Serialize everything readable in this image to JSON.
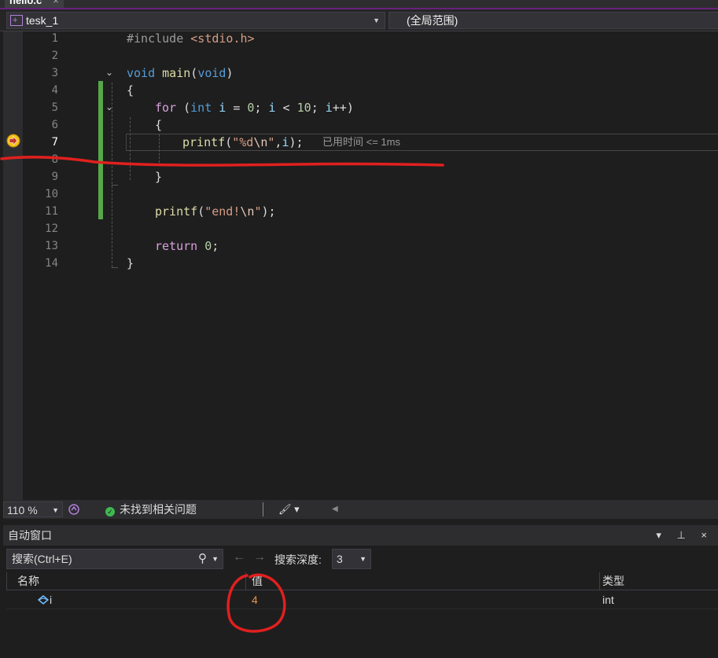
{
  "tab": {
    "title": "hello.c",
    "close": "×"
  },
  "navbar": {
    "project": "tesk_1",
    "scope": "(全局范围)"
  },
  "editor": {
    "line_numbers": [
      "1",
      "2",
      "3",
      "4",
      "5",
      "6",
      "7",
      "8",
      "9",
      "10",
      "11",
      "12",
      "13",
      "14"
    ],
    "current_line": "7",
    "elapsed": "已用时间 <= 1ms"
  },
  "code": {
    "l1_pp": "#include ",
    "l1_hdr": "<stdio.h>",
    "l3_void": "void",
    "l3_main": " main",
    "l3_paren": "(",
    "l3_void2": "void",
    "l3_close": ")",
    "brace_open": "{",
    "brace_close": "}",
    "l5_for": "for",
    "l5_a": " (",
    "l5_int": "int",
    "l5_i": " i",
    "l5_eq": " = ",
    "l5_0": "0",
    "l5_semi": "; ",
    "l5_i2": "i",
    "l5_lt": " < ",
    "l5_10": "10",
    "l5_semi2": "; ",
    "l5_i3": "i",
    "l5_pp": "++)",
    "l7_printf": "printf",
    "l7_open": "(",
    "l7_str1": "\"%d",
    "l7_esc": "\\n",
    "l7_str2": "\"",
    "l7_rest": ",",
    "l7_i": "i",
    "l7_end": ");",
    "l11_printf": "printf",
    "l11_open": "(",
    "l11_str1": "\"end!",
    "l11_esc": "\\n",
    "l11_str2": "\"",
    "l11_end": ");",
    "l13_return": "return",
    "l13_sp": " ",
    "l13_0": "0",
    "l13_semi": ";"
  },
  "statusbar": {
    "zoom": "110 %",
    "issues": "未找到相关问题"
  },
  "autos": {
    "title": "自动窗口",
    "window_controls": "▾ ⊥ ×",
    "search_placeholder": "搜索(Ctrl+E)",
    "depth_label": "搜索深度:",
    "depth_value": "3",
    "columns": [
      "名称",
      "值",
      "类型"
    ],
    "rows": [
      {
        "name": "i",
        "value": "4",
        "type": "int"
      }
    ]
  },
  "colors": {
    "accent": "#68217a",
    "change_bar": "#57a64a",
    "annotation": "#e0201e"
  }
}
